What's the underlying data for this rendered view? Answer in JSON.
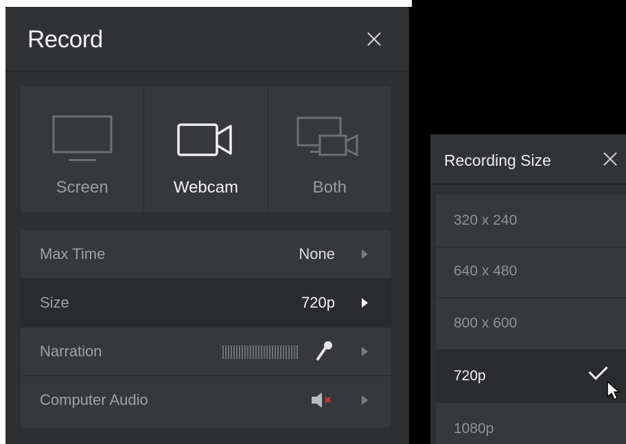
{
  "record_panel": {
    "title": "Record",
    "close_icon": "close-icon",
    "modes": [
      {
        "label": "Screen",
        "icon": "monitor-icon",
        "active": false
      },
      {
        "label": "Webcam",
        "icon": "webcam-icon",
        "active": true
      },
      {
        "label": "Both",
        "icon": "screen-webcam-icon",
        "active": false
      }
    ],
    "settings": [
      {
        "label": "Max Time",
        "value": "None"
      },
      {
        "label": "Size",
        "value": "720p",
        "selected": true
      },
      {
        "label": "Narration",
        "value": "",
        "icons": [
          "audio-meter-icon",
          "microphone-icon"
        ]
      },
      {
        "label": "Computer Audio",
        "value": "",
        "icons": [
          "speaker-muted-icon"
        ]
      }
    ]
  },
  "size_panel": {
    "title": "Recording Size",
    "close_icon": "close-icon",
    "options": [
      {
        "label": "320 x 240"
      },
      {
        "label": "640 x 480"
      },
      {
        "label": "800 x 600"
      },
      {
        "label": "720p",
        "selected": true
      },
      {
        "label": "1080p"
      }
    ]
  },
  "colors": {
    "panel_bg": "#2d2f33",
    "card_bg": "#36383c",
    "selected_bg": "#2a2b2e",
    "muted_red": "#e0312b"
  }
}
